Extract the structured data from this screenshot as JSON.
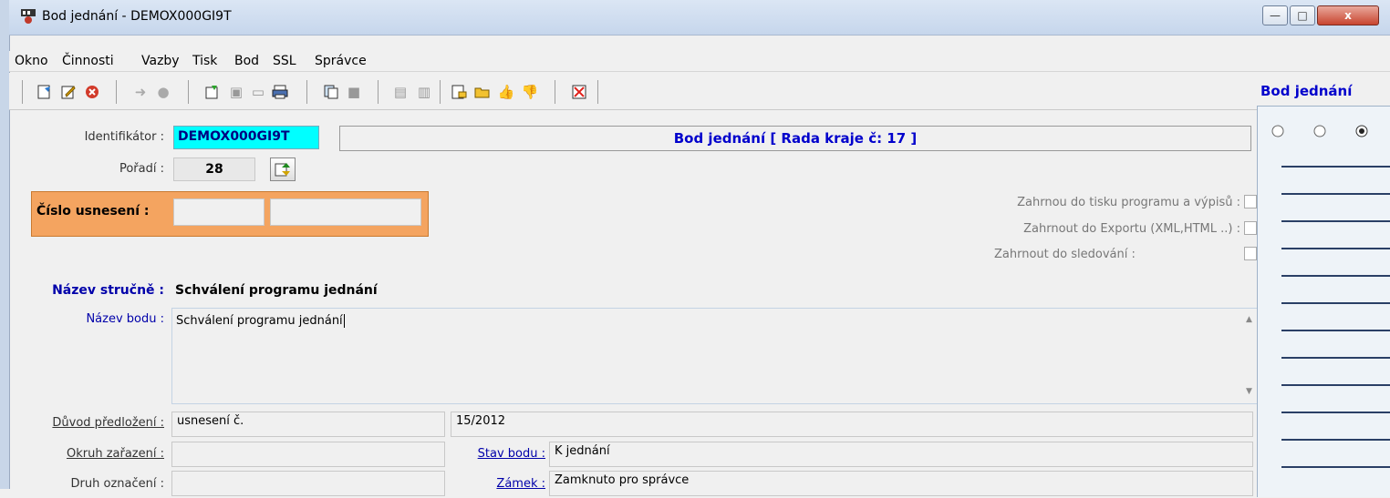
{
  "window": {
    "title": "Bod jednání - DEMOX000GI9T",
    "min": "—",
    "max": "□",
    "close": "x"
  },
  "menu": [
    "Okno",
    "Činnosti",
    "Vazby",
    "Tisk",
    "Bod",
    "SSL",
    "Správce"
  ],
  "toolbar": {
    "panel_title": "Bod jednání"
  },
  "form": {
    "identifikator_label": "Identifikátor :",
    "identifikator_value": "DEMOX000GI9T",
    "header_text": "Bod jednání [ Rada kraje č: 17 ]",
    "poradi_label": "Pořadí :",
    "poradi_value": "28",
    "cislo_usneseni_label": "Číslo usnesení :",
    "cislo_usneseni_value1": "",
    "cislo_usneseni_value2": "",
    "check1_label": "Zahrnou do tisku programu a výpisů :",
    "check2_label": "Zahrnout do Exportu (XML,HTML ..) :",
    "check3_label": "Zahrnout do sledování :",
    "nazev_strucne_label": "Název stručně :",
    "nazev_strucne_value": "Schválení programu jednání",
    "nazev_bodu_label": "Název bodu :",
    "nazev_bodu_value": "Schválení programu jednání",
    "duvod_label": "Důvod předložení :",
    "duvod_value": "usnesení č.",
    "duvod_value2": "15/2012",
    "okruh_label": "Okruh zařazení :",
    "okruh_value": "",
    "stav_label": "Stav bodu :",
    "stav_value": "K jednání",
    "druh_label": "Druh označení :",
    "druh_value": "",
    "zamek_label": "Zámek :",
    "zamek_value": "Zamknuto pro správce"
  },
  "colors": {
    "identifikator_bg": "#00ffff",
    "header_text": "#0000cc",
    "orange_panel": "#f4a460",
    "label_blue": "#0000aa"
  }
}
